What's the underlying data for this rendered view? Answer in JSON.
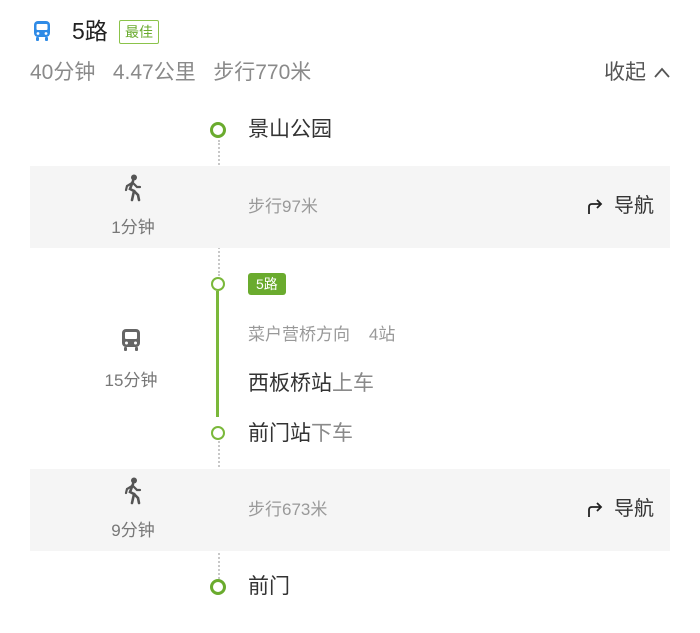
{
  "header": {
    "route_name": "5路",
    "best_badge": "最佳",
    "summary": "40分钟   4.47公里   步行770米",
    "collapse_label": "收起"
  },
  "steps": {
    "start_station": "景山公园",
    "walk1": {
      "time": "1分钟",
      "distance": "步行97米",
      "nav_label": "导航"
    },
    "bus": {
      "line_badge": "5路",
      "direction": "菜户营桥方向    4站",
      "time": "15分钟",
      "board_station": "西板桥站",
      "board_action": "上车",
      "alight_station": "前门站",
      "alight_action": "下车"
    },
    "walk2": {
      "time": "9分钟",
      "distance": "步行673米",
      "nav_label": "导航"
    },
    "end_station": "前门"
  },
  "colors": {
    "accent_green": "#6aab2e",
    "bus_icon_blue": "#2f8be6",
    "muted_gray": "#8a8a8a",
    "band_bg": "#f5f5f5"
  },
  "icons": {
    "bus_top": "bus-icon",
    "walk": "walk-icon",
    "bus_step": "bus-icon",
    "navigate": "navigate-arrow-icon",
    "collapse": "chevron-up-icon"
  }
}
